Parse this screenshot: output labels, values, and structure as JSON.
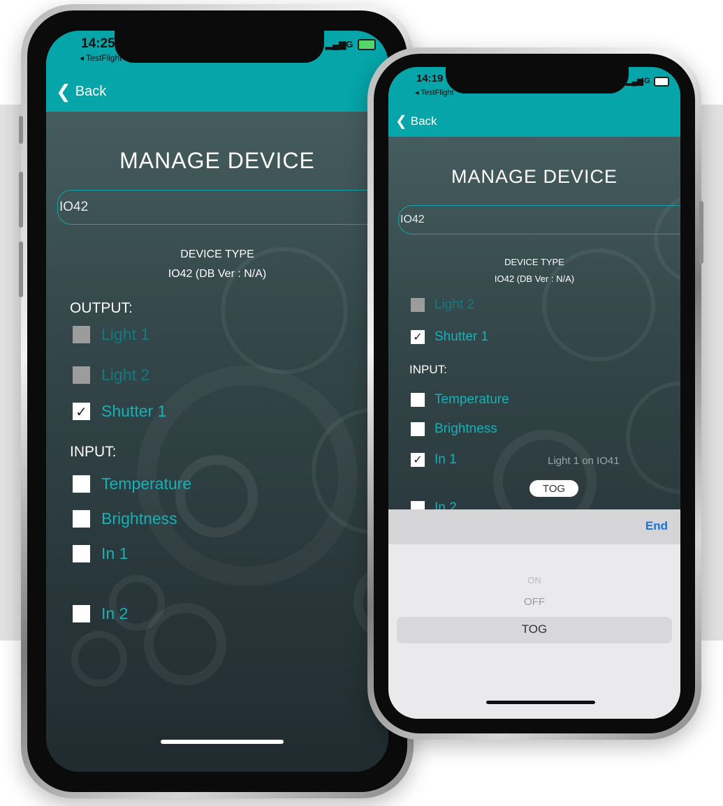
{
  "left_phone": {
    "status": {
      "time": "14:25",
      "back_app": "◂ TestFlight",
      "network": "4G"
    },
    "nav": {
      "back_label": "Back"
    },
    "title": "MANAGE DEVICE",
    "device_name": "IO42",
    "device_type_label": "DEVICE TYPE",
    "device_type_value": "IO42 (DB Ver : N/A)",
    "output_heading": "OUTPUT:",
    "outputs": [
      {
        "label": "Light 1",
        "state": "disabled"
      },
      {
        "label": "Light 2",
        "state": "disabled"
      },
      {
        "label": "Shutter 1",
        "state": "checked"
      }
    ],
    "input_heading": "INPUT:",
    "inputs": [
      {
        "label": "Temperature",
        "state": "unchecked"
      },
      {
        "label": "Brightness",
        "state": "unchecked"
      },
      {
        "label": "In 1",
        "state": "unchecked"
      },
      {
        "label": "In 2",
        "state": "unchecked"
      }
    ]
  },
  "right_phone": {
    "status": {
      "time": "14:19",
      "back_app": "◂ TestFlight",
      "network": "4G"
    },
    "nav": {
      "back_label": "Back"
    },
    "title": "MANAGE DEVICE",
    "device_name": "IO42",
    "device_type_label": "DEVICE TYPE",
    "device_type_value": "IO42 (DB Ver : N/A)",
    "outputs": [
      {
        "label": "Light 2",
        "state": "disabled"
      },
      {
        "label": "Shutter 1",
        "state": "checked"
      }
    ],
    "input_heading": "INPUT:",
    "inputs": [
      {
        "label": "Temperature",
        "state": "unchecked"
      },
      {
        "label": "Brightness",
        "state": "unchecked"
      },
      {
        "label": "In 1",
        "state": "checked"
      }
    ],
    "in1_target": "Light 1 on IO41",
    "action_value": "TOG",
    "next_row_partial": "In 2",
    "toolbar_done": "End",
    "picker_options": [
      "ON",
      "OFF",
      "TOG"
    ],
    "picker_selected": "TOG"
  },
  "colors": {
    "accent": "#05a5a9",
    "label": "#15b1b5",
    "done": "#1f6fd6"
  }
}
